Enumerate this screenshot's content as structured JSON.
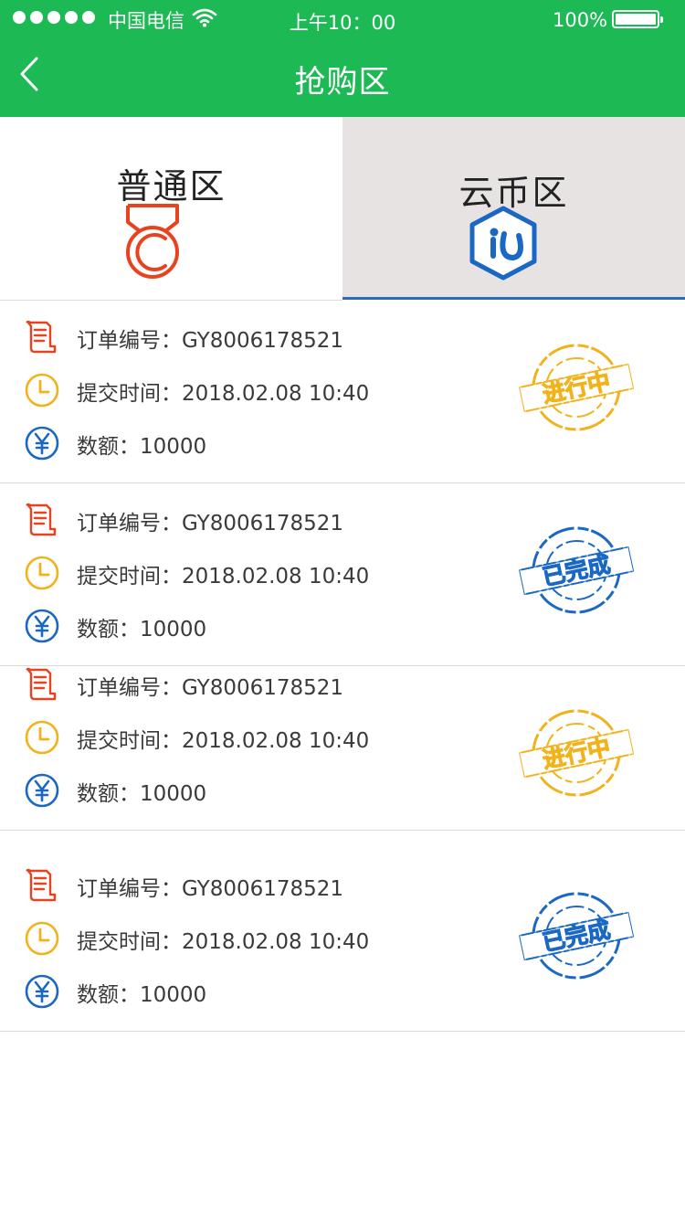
{
  "status_bar": {
    "carrier": "中国电信",
    "time": "上午10：00",
    "battery": "100%",
    "icons": [
      "signal-dots",
      "wifi-icon",
      "battery-icon"
    ]
  },
  "nav": {
    "title": "抢购区",
    "back_icon": "chevron-left-icon"
  },
  "tabs": [
    {
      "label": "普通区",
      "icon": "medal-icon",
      "color": "#e8421f",
      "selected": false
    },
    {
      "label": "云币区",
      "icon": "hexagon-logo-icon",
      "color": "#1a68c4",
      "selected": true
    }
  ],
  "orders": [
    {
      "order_no": "订单编号：GY8006178521",
      "time": "提交时间：2018.02.08  10:40",
      "amount": "数额：10000",
      "status": "进行中",
      "status_color": "#f2b21b"
    },
    {
      "order_no": "订单编号：GY8006178521",
      "time": "提交时间：2018.02.08  10:40",
      "amount": "数额：10000",
      "status": "已完成",
      "status_color": "#1a68c4"
    },
    {
      "order_no": "订单编号：GY8006178521",
      "time": "提交时间：2018.02.08  10:40",
      "amount": "数额：10000",
      "status": "进行中",
      "status_color": "#f2b21b"
    },
    {
      "order_no": "订单编号：GY8006178521",
      "time": "提交时间：2018.02.08  10:40",
      "amount": "数额：10000",
      "status": "已完成",
      "status_color": "#1a68c4"
    }
  ],
  "colors": {
    "header_green": "#1cb954",
    "receipt_red": "#e8421f",
    "clock_yellow": "#f2b21b",
    "yen_blue": "#1a68c4"
  }
}
